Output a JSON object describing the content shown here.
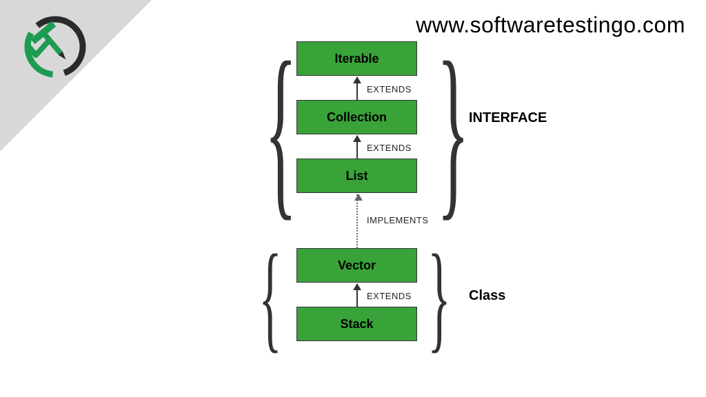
{
  "url": "www.softwaretestingo.com",
  "colors": {
    "box_bg": "#39a33a",
    "triangle": "#d8d8d8",
    "logo_green": "#1e9b52",
    "logo_dark": "#2a2a2a"
  },
  "groups": {
    "interface": {
      "label": "INTERFACE"
    },
    "class": {
      "label": "Class"
    }
  },
  "nodes": {
    "iterable": {
      "label": "Iterable"
    },
    "collection": {
      "label": "Collection"
    },
    "list": {
      "label": "List"
    },
    "vector": {
      "label": "Vector"
    },
    "stack": {
      "label": "Stack"
    }
  },
  "edges": {
    "collection_iterable": {
      "label": "EXTENDS"
    },
    "list_collection": {
      "label": "EXTENDS"
    },
    "vector_list": {
      "label": "IMPLEMENTS"
    },
    "stack_vector": {
      "label": "EXTENDS"
    }
  }
}
